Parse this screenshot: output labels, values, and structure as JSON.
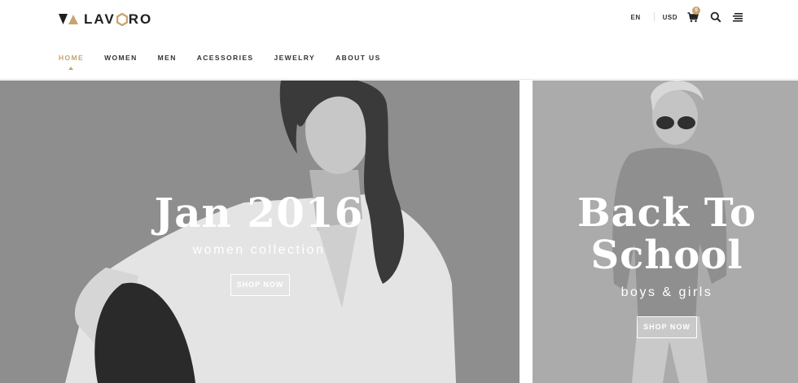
{
  "brand": {
    "name_part1": "LAV",
    "name_part2": "RO"
  },
  "header": {
    "language": "EN",
    "currency": "USD",
    "cart_count": "0"
  },
  "nav": {
    "items": [
      "HOME",
      "WOMEN",
      "MEN",
      "ACESSORIES",
      "JEWELRY",
      "ABOUT US"
    ]
  },
  "banners": {
    "left": {
      "title": "Jan 2016",
      "subtitle": "women collection",
      "button": "SHOP NOW"
    },
    "right": {
      "title_line1": "Back To",
      "title_line2": "School",
      "subtitle": "boys & girls",
      "button": "SHOP NOW"
    }
  },
  "colors": {
    "accent": "#c8a46e",
    "text": "#333333"
  },
  "icons": [
    "logo-mark-icon",
    "cart-icon",
    "search-icon",
    "menu-icon"
  ]
}
